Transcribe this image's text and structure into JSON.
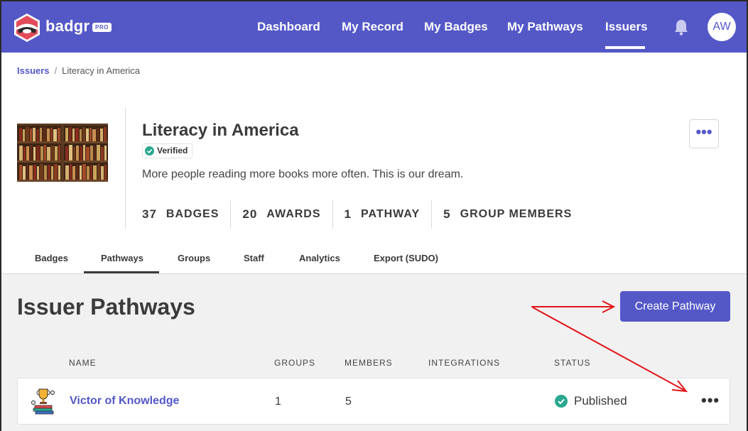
{
  "brand": {
    "name": "badgr",
    "badge": "PRO"
  },
  "nav": {
    "items": [
      {
        "label": "Dashboard"
      },
      {
        "label": "My Record"
      },
      {
        "label": "My Badges"
      },
      {
        "label": "My Pathways"
      },
      {
        "label": "Issuers",
        "active": true
      }
    ],
    "avatar_initials": "AW",
    "bell_icon": "bell-icon"
  },
  "breadcrumb": {
    "parent": "Issuers",
    "separator": "/",
    "current": "Literacy in America"
  },
  "issuer": {
    "title": "Literacy in America",
    "verified_label": "Verified",
    "description": "More people reading more books more often. This is our dream.",
    "more_label": "•••",
    "stats": [
      {
        "num": "37",
        "label": "BADGES"
      },
      {
        "num": "20",
        "label": "AWARDS"
      },
      {
        "num": "1",
        "label": "PATHWAY"
      },
      {
        "num": "5",
        "label": "GROUP MEMBERS"
      }
    ]
  },
  "tabs": [
    {
      "label": "Badges"
    },
    {
      "label": "Pathways",
      "active": true
    },
    {
      "label": "Groups"
    },
    {
      "label": "Staff"
    },
    {
      "label": "Analytics"
    },
    {
      "label": "Export (SUDO)"
    }
  ],
  "pathways": {
    "title": "Issuer Pathways",
    "create_label": "Create Pathway",
    "columns": [
      "NAME",
      "GROUPS",
      "MEMBERS",
      "INTEGRATIONS",
      "STATUS"
    ],
    "rows": [
      {
        "name": "Victor of Knowledge",
        "groups": "1",
        "members": "5",
        "integrations": "",
        "status": "Published",
        "more": "•••"
      }
    ]
  },
  "colors": {
    "brand": "#5458c7",
    "success": "#2aa890",
    "annotation": "#e0161b"
  }
}
